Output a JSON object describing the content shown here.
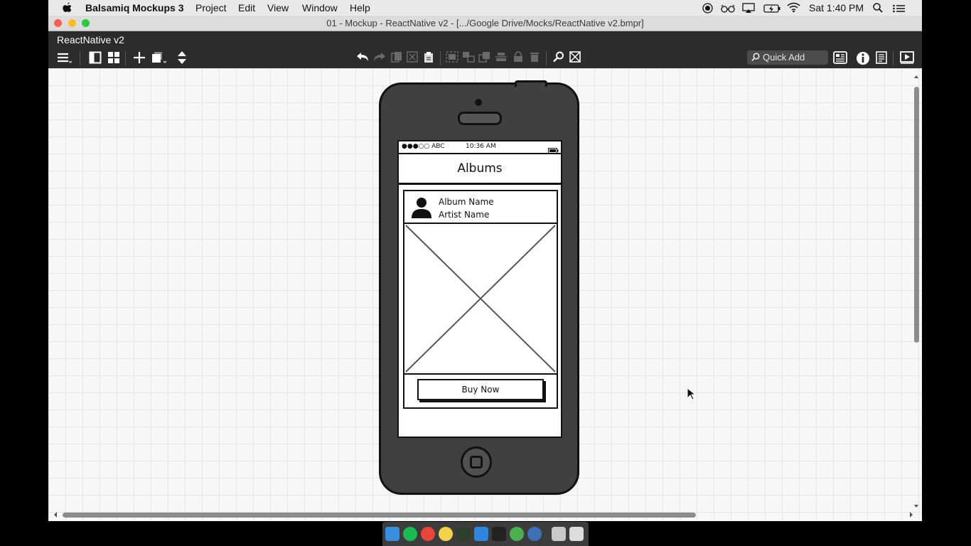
{
  "menubar": {
    "app_name": "Balsamiq Mockups 3",
    "menus": [
      "Project",
      "Edit",
      "View",
      "Window",
      "Help"
    ],
    "clock": "Sat 1:40 PM"
  },
  "window": {
    "title": "01 - Mockup - ReactNative v2 - [.../Google Drive/Mocks/ReactNative v2.bmpr]"
  },
  "toolbar": {
    "project_name": "ReactNative v2",
    "quick_add_label": "Quick Add"
  },
  "mockup": {
    "status_carrier": "●●●○○ ABC",
    "status_time": "10:36 AM",
    "nav_title": "Albums",
    "album_name": "Album Name",
    "artist_name": "Artist Name",
    "button_label": "Buy Now"
  },
  "colors": {
    "toolbar_bg": "#2c2c2c",
    "phone_body": "#404040",
    "traffic_red": "#fc5f57",
    "traffic_yellow": "#fdbc2e",
    "traffic_green": "#28c840"
  }
}
